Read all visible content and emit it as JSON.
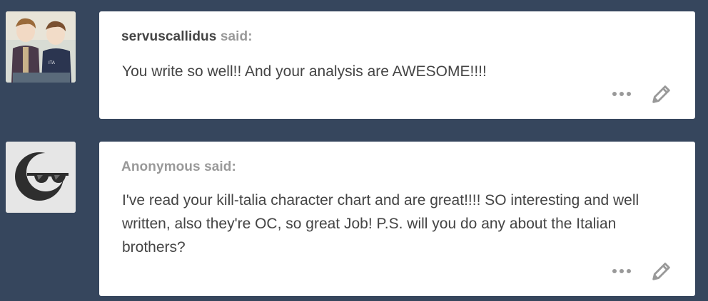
{
  "posts": [
    {
      "asker_name": "servuscallidus",
      "said_label": "said:",
      "message": "You write so well!! And your analysis are AWESOME!!!!",
      "avatar_icon": "anime-characters-avatar",
      "more_icon": "ellipsis-icon",
      "edit_icon": "pencil-icon"
    },
    {
      "asker_name": "Anonymous",
      "said_label": "said:",
      "message": "I've read your kill-talia character chart and are great!!!! SO interesting and well written, also they're OC, so great Job! P.S. will you do any about the Italian brothers?",
      "avatar_icon": "anonymous-sunglasses-avatar",
      "more_icon": "ellipsis-icon",
      "edit_icon": "pencil-icon"
    }
  ],
  "colors": {
    "background": "#36465d",
    "card": "#ffffff",
    "text": "#444444",
    "muted": "#999999"
  }
}
